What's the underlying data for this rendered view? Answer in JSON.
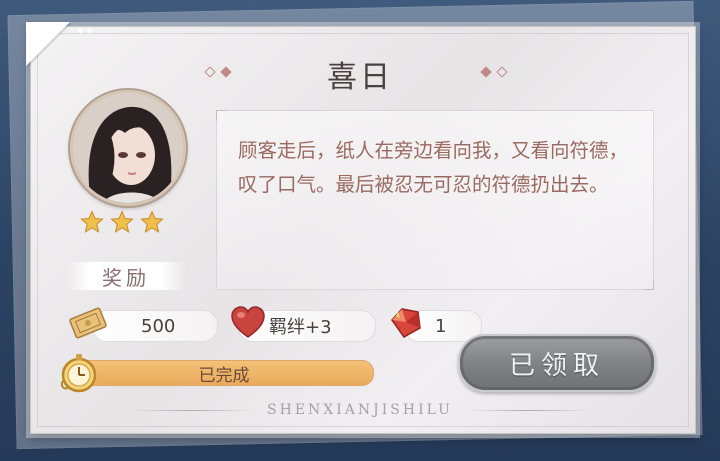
{
  "event": {
    "title": "喜日",
    "rarity_stars": 3,
    "story": "顾客走后，纸人在旁边看向我，又看向符德，叹了口气。最后被忍无可忍的符德扔出去。"
  },
  "rewards": {
    "label": "奖励",
    "items": [
      {
        "icon": "ticket-coin-icon",
        "text": "500"
      },
      {
        "icon": "heart-bond-icon",
        "text": "羁绊+3"
      },
      {
        "icon": "red-gem-icon",
        "text": "1"
      }
    ]
  },
  "progress": {
    "status": "已完成",
    "fraction": 1.0
  },
  "claim_button": {
    "label": "已领取",
    "state": "claimed"
  },
  "footer": {
    "brand": "SHENXIANJISHILU"
  },
  "colors": {
    "background": "#2d4363",
    "story_text": "#9a6a60",
    "progress_fill": "#eaa95b",
    "button_disabled": "#7e8184"
  }
}
